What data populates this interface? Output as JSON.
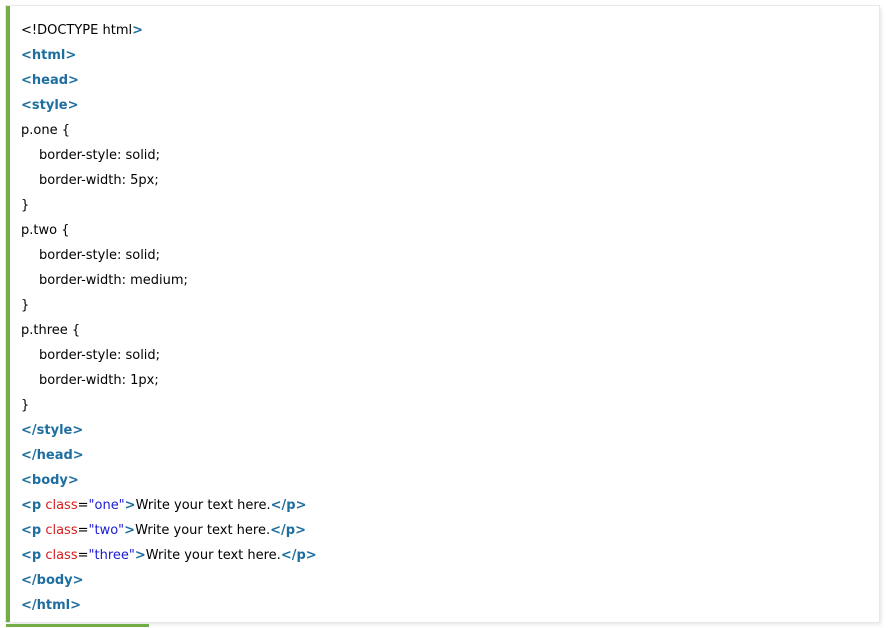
{
  "colors": {
    "accent_border": "#73ad45",
    "tag": "#1f6ea0",
    "attribute": "#d61c1c",
    "attribute_value": "#1b1bd6",
    "text": "#000000"
  },
  "code": {
    "doctype_open": "<!DOCTYPE html",
    "doctype_close": ">",
    "html_open": "<html>",
    "head_open": "<head>",
    "style_open": "<style>",
    "sel_one": "p.one {",
    "one_style": "border-style: solid;",
    "one_width": "border-width: 5px;",
    "close1": "}",
    "sel_two": "p.two {",
    "two_style": "border-style: solid;",
    "two_width": "border-width: medium;",
    "close2": "}",
    "sel_three": "p.three {",
    "three_style": "border-style: solid;",
    "three_width": "border-width: 1px;",
    "close3": "}",
    "style_close": "</style>",
    "head_close": "</head>",
    "body_open": "<body>",
    "p_open": "<p",
    "class_attr": " class",
    "equals": "=",
    "val_one": "\"one\"",
    "val_two": "\"two\"",
    "val_three": "\"three\"",
    "gt": ">",
    "text_one": "Write your text here.",
    "text_two": "Write your text here.",
    "text_three": "Write your text here.",
    "p_close": "</p>",
    "body_close": "</body>",
    "html_close": "</html>"
  }
}
